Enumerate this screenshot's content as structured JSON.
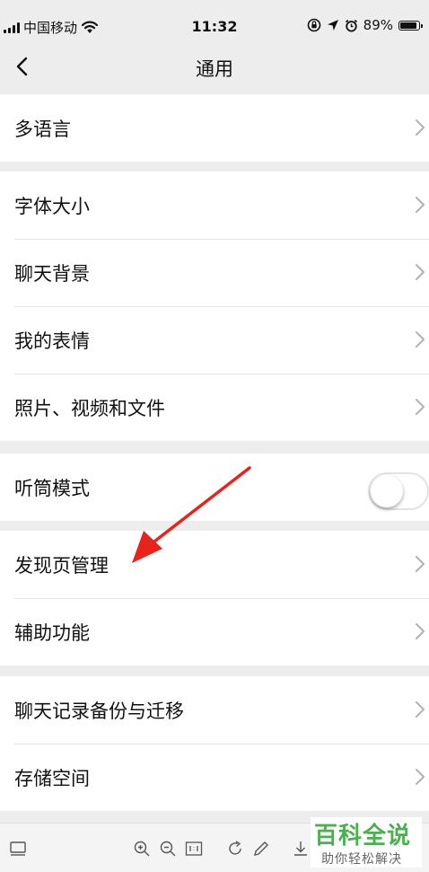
{
  "status_bar": {
    "carrier": "中国移动",
    "time": "11:32",
    "battery": "89%",
    "battery_level": 0.89
  },
  "nav": {
    "title": "通用"
  },
  "groups": [
    [
      {
        "label": "多语言"
      }
    ],
    [
      {
        "label": "字体大小"
      },
      {
        "label": "聊天背景"
      },
      {
        "label": "我的表情"
      },
      {
        "label": "照片、视频和文件"
      }
    ],
    [
      {
        "label": "听筒模式",
        "toggle": false
      }
    ],
    [
      {
        "label": "发现页管理"
      },
      {
        "label": "辅助功能"
      }
    ],
    [
      {
        "label": "聊天记录备份与迁移"
      },
      {
        "label": "存储空间"
      }
    ]
  ],
  "watermark": {
    "title": "百科全说",
    "subtitle": "助你轻松解决"
  },
  "colors": {
    "background": "#ededed",
    "row": "#ffffff",
    "annotation_arrow": "#e8231b",
    "watermark_green": "#4caf50"
  }
}
